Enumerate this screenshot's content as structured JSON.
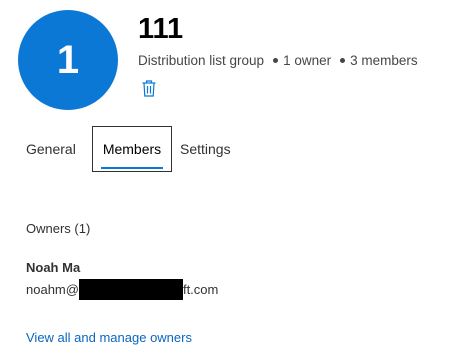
{
  "group": {
    "avatar_initial": "1",
    "title": "111",
    "type": "Distribution list group",
    "owners_count": "1 owner",
    "members_count": "3 members",
    "delete_icon": "trash-icon"
  },
  "tabs": [
    {
      "label": "General"
    },
    {
      "label": "Members",
      "selected": true
    },
    {
      "label": "Settings"
    }
  ],
  "owners_section": {
    "heading": "Owners (1)",
    "owner": {
      "name": "Noah Ma",
      "email_prefix": "noahm@",
      "email_suffix": "ft.com"
    },
    "manage_link": "View all and manage owners"
  },
  "colors": {
    "accent": "#0a78d4",
    "link": "#0a66c0"
  }
}
